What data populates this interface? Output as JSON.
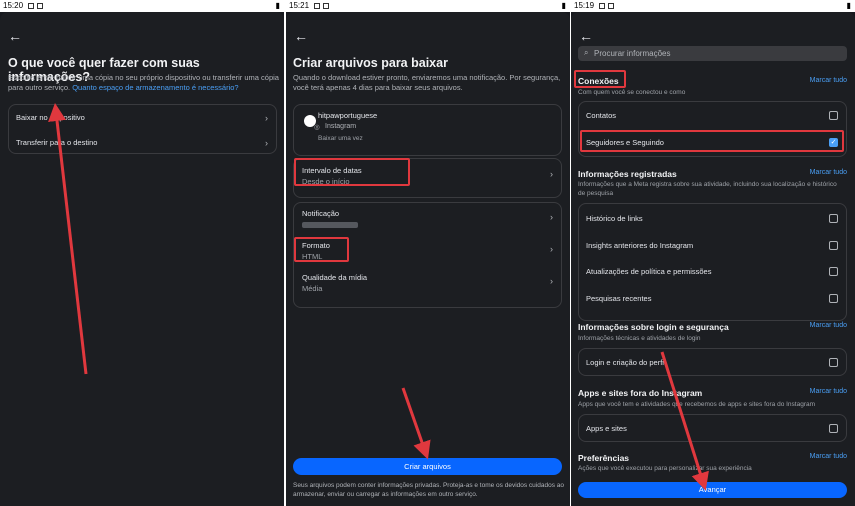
{
  "panel1": {
    "time": "15:20",
    "title": "O que você quer fazer com suas informações?",
    "desc": "Escolha entre baixar uma cópia no seu próprio dispositivo ou transferir uma cópia para outro serviço.",
    "link": "Quanto espaço de armazenamento é necessário?",
    "options": [
      "Baixar no dispositivo",
      "Transferir para o destino"
    ]
  },
  "panel2": {
    "time": "15:21",
    "title": "Criar arquivos para baixar",
    "desc": "Quando o download estiver pronto, enviaremos uma notificação. Por segurança, você terá apenas 4 dias para baixar seus arquivos.",
    "account": {
      "name": "hitpawportuguese",
      "service": "Instagram",
      "freq": "Baixar uma vez"
    },
    "date_range": {
      "label": "Intervalo de datas",
      "value": "Desde o início"
    },
    "notification": {
      "label": "Notificação"
    },
    "format": {
      "label": "Formato",
      "value": "HTML"
    },
    "quality": {
      "label": "Qualidade da mídia",
      "value": "Média"
    },
    "create_button": "Criar arquivos",
    "footer": "Seus arquivos podem conter informações privadas. Proteja-as e tome os devidos cuidados ao armazenar, enviar ou carregar as informações em outro serviço."
  },
  "panel3": {
    "time": "15:19",
    "search_placeholder": "Procurar informações",
    "mark_all": "Marcar tudo",
    "sections": {
      "conexoes": {
        "title": "Conexões",
        "desc": "Com quem você se conectou e como",
        "items": [
          "Contatos",
          "Seguidores e Seguindo"
        ]
      },
      "registradas": {
        "title": "Informações registradas",
        "desc": "Informações que a Meta registra sobre sua atividade, incluindo sua localização e histórico de pesquisa",
        "items": [
          "Histórico de links",
          "Insights anteriores do Instagram",
          "Atualizações de política e permissões",
          "Pesquisas recentes"
        ]
      },
      "login": {
        "title": "Informações sobre login e segurança",
        "desc": "Informações técnicas e atividades de login",
        "items": [
          "Login e criação do perfil"
        ]
      },
      "apps": {
        "title": "Apps e sites fora do Instagram",
        "desc": "Apps que você tem e atividades que recebemos de apps e sites fora do Instagram",
        "items": [
          "Apps e sites"
        ]
      },
      "pref": {
        "title": "Preferências",
        "desc": "Ações que você executou para personalizar sua experiência"
      }
    },
    "advance_button": "Avançar"
  }
}
